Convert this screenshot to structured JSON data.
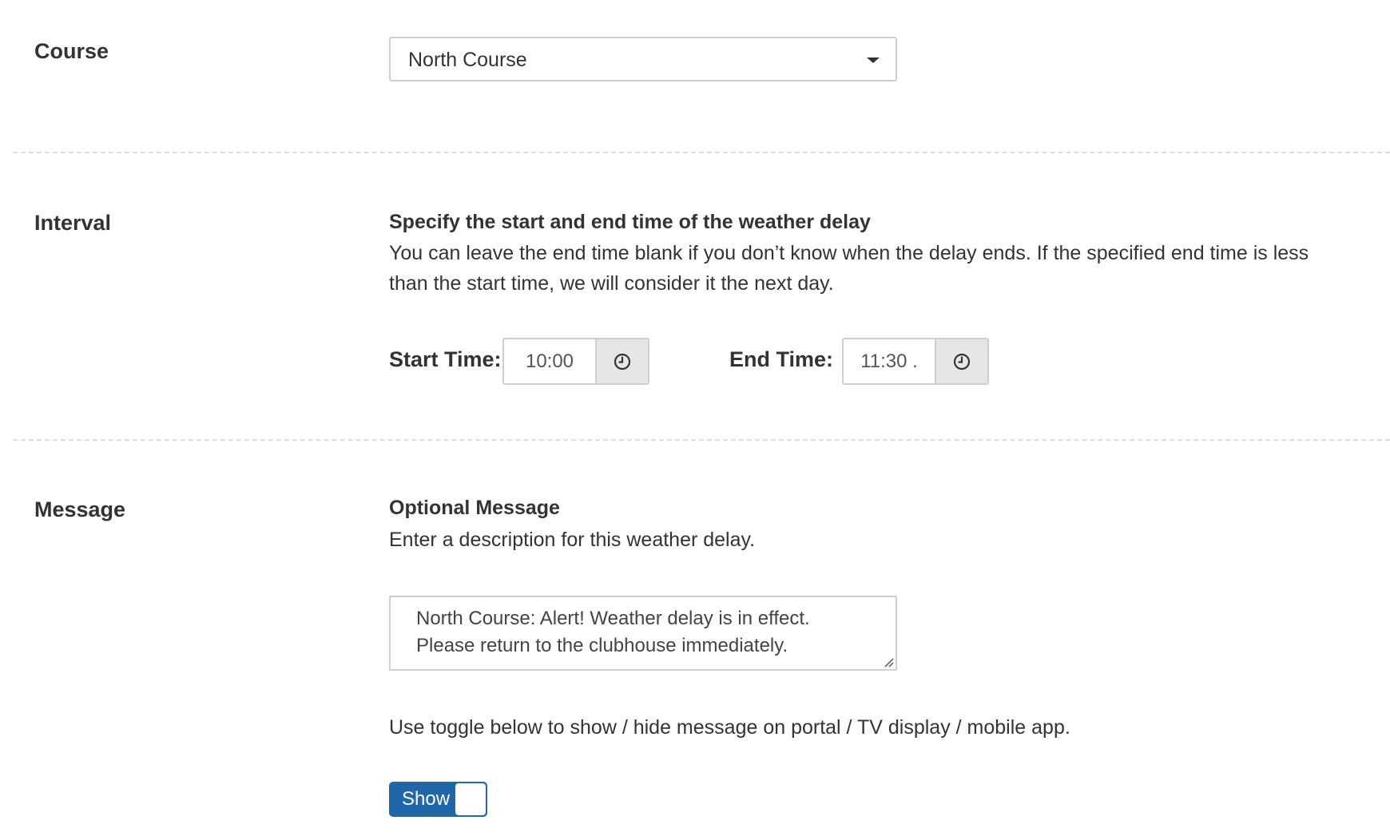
{
  "course": {
    "label": "Course",
    "selected": "North Course"
  },
  "interval": {
    "label": "Interval",
    "heading": "Specify the start and end time of the weather delay",
    "description_line1": "You can leave the end time blank if you don’t know when the delay ends. If the specified end time is less",
    "description_line2": "than the start time, we will consider it the next day.",
    "start_label": "Start Time:",
    "start_value": "10:00",
    "end_label": "End Time:",
    "end_value": "11:30 ."
  },
  "message": {
    "label": "Message",
    "heading": "Optional Message",
    "description": "Enter a description for this weather delay.",
    "text_line1": "North Course: Alert! Weather delay is in effect.",
    "text_line2": "Please return to the clubhouse immediately.",
    "toggle_hint": "Use toggle below to show / hide message on portal / TV display / mobile app.",
    "toggle_label": "Show",
    "toggle_on": true
  },
  "colors": {
    "accent": "#1f67a8",
    "text": "#333333",
    "border": "#cfcfcf",
    "divider": "#d9dde3"
  },
  "icons": {
    "time_button": "clock-icon",
    "select_caret": "caret-down-icon"
  }
}
